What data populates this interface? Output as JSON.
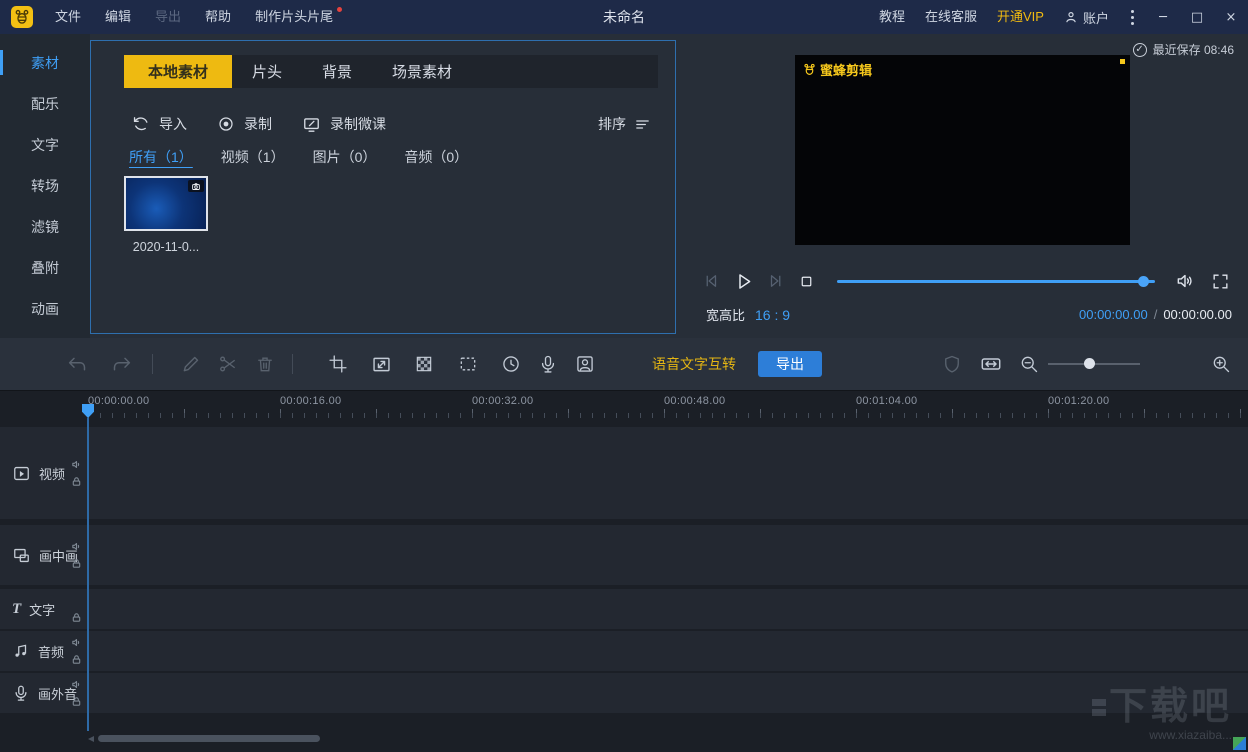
{
  "titlebar": {
    "menus": [
      "文件",
      "编辑",
      "导出",
      "帮助",
      "制作片头片尾"
    ],
    "title": "未命名",
    "links": [
      "教程",
      "在线客服",
      "开通VIP",
      "账户"
    ]
  },
  "icons": {
    "minimize": "─",
    "maximize": "□",
    "close": "×",
    "check": "✓",
    "text_track": "T"
  },
  "sidebar": {
    "items": [
      "素材",
      "配乐",
      "文字",
      "转场",
      "滤镜",
      "叠附",
      "动画"
    ]
  },
  "media": {
    "tabs": [
      "本地素材",
      "片头",
      "背景",
      "场景素材"
    ],
    "actions": {
      "import": "导入",
      "record": "录制",
      "record_lesson": "录制微课",
      "sort": "排序"
    },
    "filters": [
      "所有（1）",
      "视频（1）",
      "图片（0）",
      "音频（0）"
    ],
    "items": [
      {
        "caption": "2020-11-0..."
      }
    ]
  },
  "preview": {
    "save_status": "最近保存 08:46",
    "video_watermark": "蜜蜂剪辑",
    "aspect_label": "宽高比",
    "aspect_value": "16 : 9",
    "current_time": "00:00:00.00",
    "time_separator": "/",
    "total_time": "00:00:00.00"
  },
  "toolbar": {
    "voice_text": "语音文字互转",
    "export": "导出"
  },
  "timeline": {
    "ruler_labels": [
      "00:00:00.00",
      "00:00:16.00",
      "00:00:32.00",
      "00:00:48.00",
      "00:01:04.00",
      "00:01:20.00"
    ],
    "tracks": [
      {
        "label": "视频"
      },
      {
        "label": "画中画"
      },
      {
        "label": "文字"
      },
      {
        "label": "音频"
      },
      {
        "label": "画外音"
      }
    ]
  },
  "site_watermark": {
    "name": "下载吧",
    "url": "www.xiazaiba..."
  },
  "colors": {
    "accent_blue": "#3f9ff6",
    "accent_yellow": "#eeba11",
    "export_blue": "#2d7ed8",
    "titlebar_navy": "#1e2a48"
  }
}
